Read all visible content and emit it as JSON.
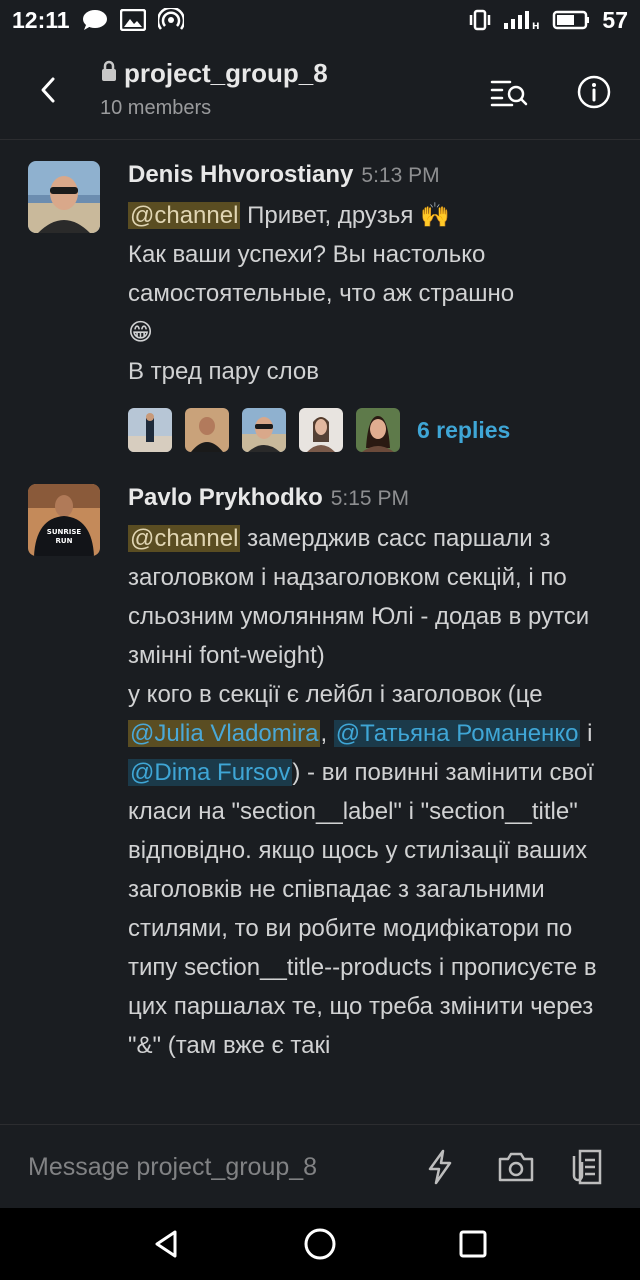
{
  "status_bar": {
    "time": "12:11",
    "battery": "57"
  },
  "header": {
    "channel_name": "project_group_8",
    "members": "10 members"
  },
  "messages": [
    {
      "author": "Denis Hhvorostiany",
      "time": "5:13 PM",
      "mention": "@channel",
      "line1_rest": " Привет, друзья 🙌",
      "line2": "Как ваши успехи? Вы настолько",
      "line3": "самостоятельные, что аж страшно",
      "line4": "😁",
      "line5": "В тред пару слов",
      "replies": "6 replies"
    },
    {
      "author": "Pavlo Prykhodko",
      "time": "5:15 PM",
      "mention": "@channel",
      "seg1": " замерджив сасс паршали з заголовком і надзаголовком секцій, і по сльозним умолянням Юлі - додав в рутси змінні font-weight)",
      "seg2": "у кого в секції є лейбл і заголовок (це ",
      "mention_julia": "@Julia Vladomira",
      "seg3": ", ",
      "mention_tatyana": "@Татьяна Романенко",
      "seg4": " і ",
      "mention_dima": "@Dima Fursov",
      "seg5": ") - ви повинні замінити свої класи на \"section__label\" і \"section__title\" відповідно. якщо щось у стилізації ваших заголовків не співпадає з загальними стилями, то ви робите модифікатори по типу section__title--products і прописуєте в цих паршалах те, що треба змінити через \"&\" (там вже є такі"
    }
  ],
  "composer": {
    "placeholder": "Message project_group_8"
  },
  "colors": {
    "background": "#1a1d21",
    "mention_link": "#3fa6d6",
    "mention_highlight": "#5a4d22"
  }
}
